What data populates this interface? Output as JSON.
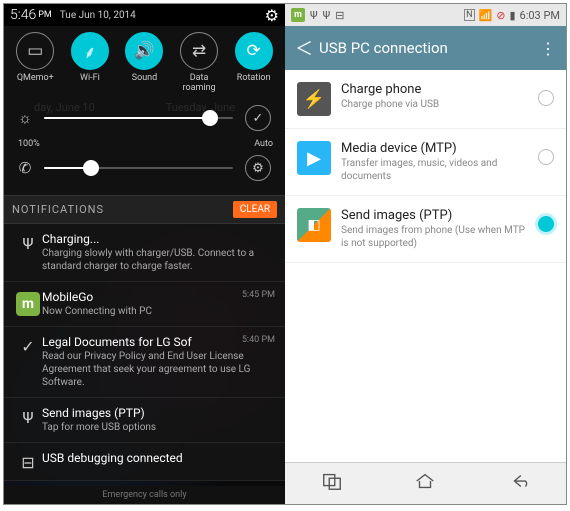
{
  "left": {
    "time": "5:46",
    "ampm": "PM",
    "date": "Tue Jun 10, 2014",
    "toggles": [
      {
        "label": "QMemo+",
        "icon": "▭",
        "on": false
      },
      {
        "label": "Wi-Fi",
        "icon": "⸙",
        "on": true
      },
      {
        "label": "Sound",
        "icon": "🔊",
        "on": true
      },
      {
        "label": "Data\nroaming",
        "icon": "⇄",
        "on": false
      },
      {
        "label": "Rotation",
        "icon": "⟳",
        "on": true
      }
    ],
    "brightness_pct": "100%",
    "auto_label": "Auto",
    "notif_header": "NOTIFICATIONS",
    "clear": "CLEAR",
    "notifs": [
      {
        "icon": "usb",
        "title": "Charging...",
        "text": "Charging slowly with charger/USB. Connect to a standard charger to charge faster.",
        "time": ""
      },
      {
        "icon": "mgo",
        "title": "MobileGo",
        "text": "Now Connecting with PC",
        "time": "5:45 PM"
      },
      {
        "icon": "check",
        "title": "Legal Documents for LG Sof",
        "text": "Read our Privacy Policy and End User License Agreement that seek your agreement to use LG Software.",
        "time": "5:40 PM"
      },
      {
        "icon": "usb",
        "title": "Send images (PTP)",
        "text": "Tap for more USB options",
        "time": ""
      },
      {
        "icon": "dash",
        "title": "USB debugging connected",
        "text": "",
        "time": ""
      }
    ],
    "footer": "Emergency calls only"
  },
  "right": {
    "status_time": "6:03 PM",
    "header": "USB PC connection",
    "options": [
      {
        "title": "Charge phone",
        "text": "Charge phone via USB",
        "sel": false
      },
      {
        "title": "Media device (MTP)",
        "text": "Transfer images, music, videos and documents",
        "sel": false
      },
      {
        "title": "Send images (PTP)",
        "text": "Send images from phone (Use when MTP is not supported)",
        "sel": true
      }
    ]
  }
}
